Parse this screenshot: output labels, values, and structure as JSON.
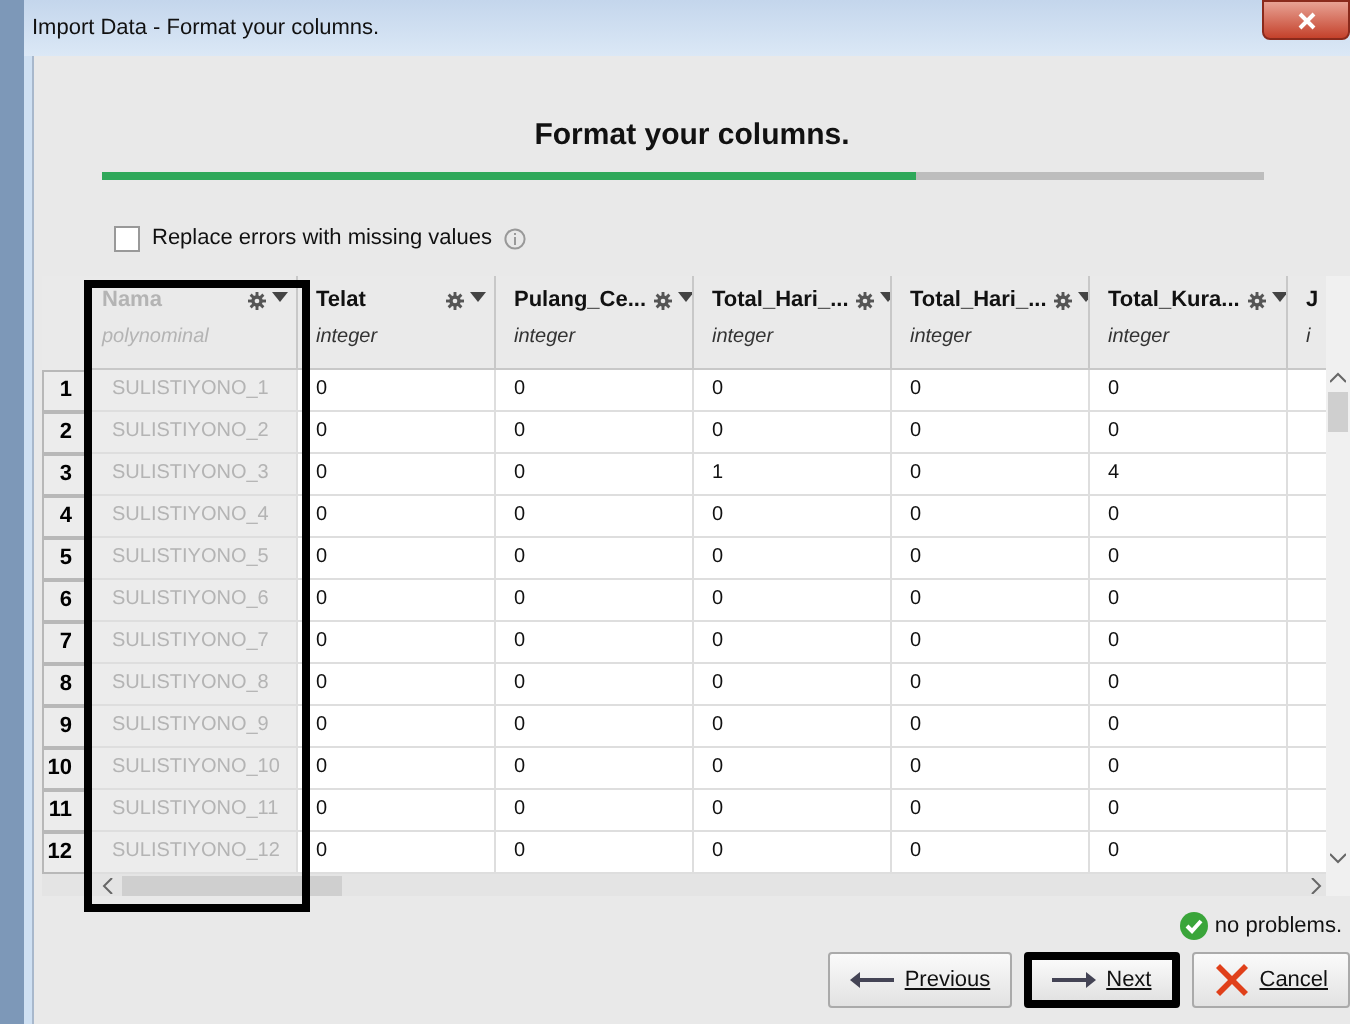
{
  "window": {
    "title": "Import Data - Format your columns."
  },
  "heading": "Format your columns.",
  "progress": {
    "level": 0.7
  },
  "replace_errors": {
    "label": "Replace errors with missing values",
    "checked": false
  },
  "table": {
    "columns": [
      {
        "name": "Nama",
        "type": "polynominal",
        "excluded": true
      },
      {
        "name": "Telat",
        "type": "integer",
        "excluded": false
      },
      {
        "name": "Pulang_Ce...",
        "type": "integer",
        "excluded": false
      },
      {
        "name": "Total_Hari_...",
        "type": "integer",
        "excluded": false
      },
      {
        "name": "Total_Hari_...",
        "type": "integer",
        "excluded": false
      },
      {
        "name": "Total_Kura...",
        "type": "integer",
        "excluded": false
      },
      {
        "name": "J",
        "type": "i",
        "excluded": false
      }
    ],
    "rows": [
      {
        "number": "1",
        "cells": [
          "SULISTIYONO_1",
          "0",
          "0",
          "0",
          "0",
          "0"
        ]
      },
      {
        "number": "2",
        "cells": [
          "SULISTIYONO_2",
          "0",
          "0",
          "0",
          "0",
          "0"
        ]
      },
      {
        "number": "3",
        "cells": [
          "SULISTIYONO_3",
          "0",
          "0",
          "1",
          "0",
          "4"
        ]
      },
      {
        "number": "4",
        "cells": [
          "SULISTIYONO_4",
          "0",
          "0",
          "0",
          "0",
          "0"
        ]
      },
      {
        "number": "5",
        "cells": [
          "SULISTIYONO_5",
          "0",
          "0",
          "0",
          "0",
          "0"
        ]
      },
      {
        "number": "6",
        "cells": [
          "SULISTIYONO_6",
          "0",
          "0",
          "0",
          "0",
          "0"
        ]
      },
      {
        "number": "7",
        "cells": [
          "SULISTIYONO_7",
          "0",
          "0",
          "0",
          "0",
          "0"
        ]
      },
      {
        "number": "8",
        "cells": [
          "SULISTIYONO_8",
          "0",
          "0",
          "0",
          "0",
          "0"
        ]
      },
      {
        "number": "9",
        "cells": [
          "SULISTIYONO_9",
          "0",
          "0",
          "0",
          "0",
          "0"
        ]
      },
      {
        "number": "10",
        "cells": [
          "SULISTIYONO_10",
          "0",
          "0",
          "0",
          "0",
          "0"
        ]
      },
      {
        "number": "11",
        "cells": [
          "SULISTIYONO_11",
          "0",
          "0",
          "0",
          "0",
          "0"
        ]
      },
      {
        "number": "12",
        "cells": [
          "SULISTIYONO_12",
          "0",
          "0",
          "0",
          "0",
          "0"
        ]
      }
    ]
  },
  "status": "no problems.",
  "buttons": [
    {
      "kind": "previous",
      "label": "Previous",
      "highlighted": false
    },
    {
      "kind": "next",
      "label": "Next",
      "highlighted": true
    },
    {
      "kind": "cancel",
      "label": "Cancel",
      "highlighted": false
    }
  ],
  "annotations": [
    {
      "kind": "column-box"
    }
  ]
}
